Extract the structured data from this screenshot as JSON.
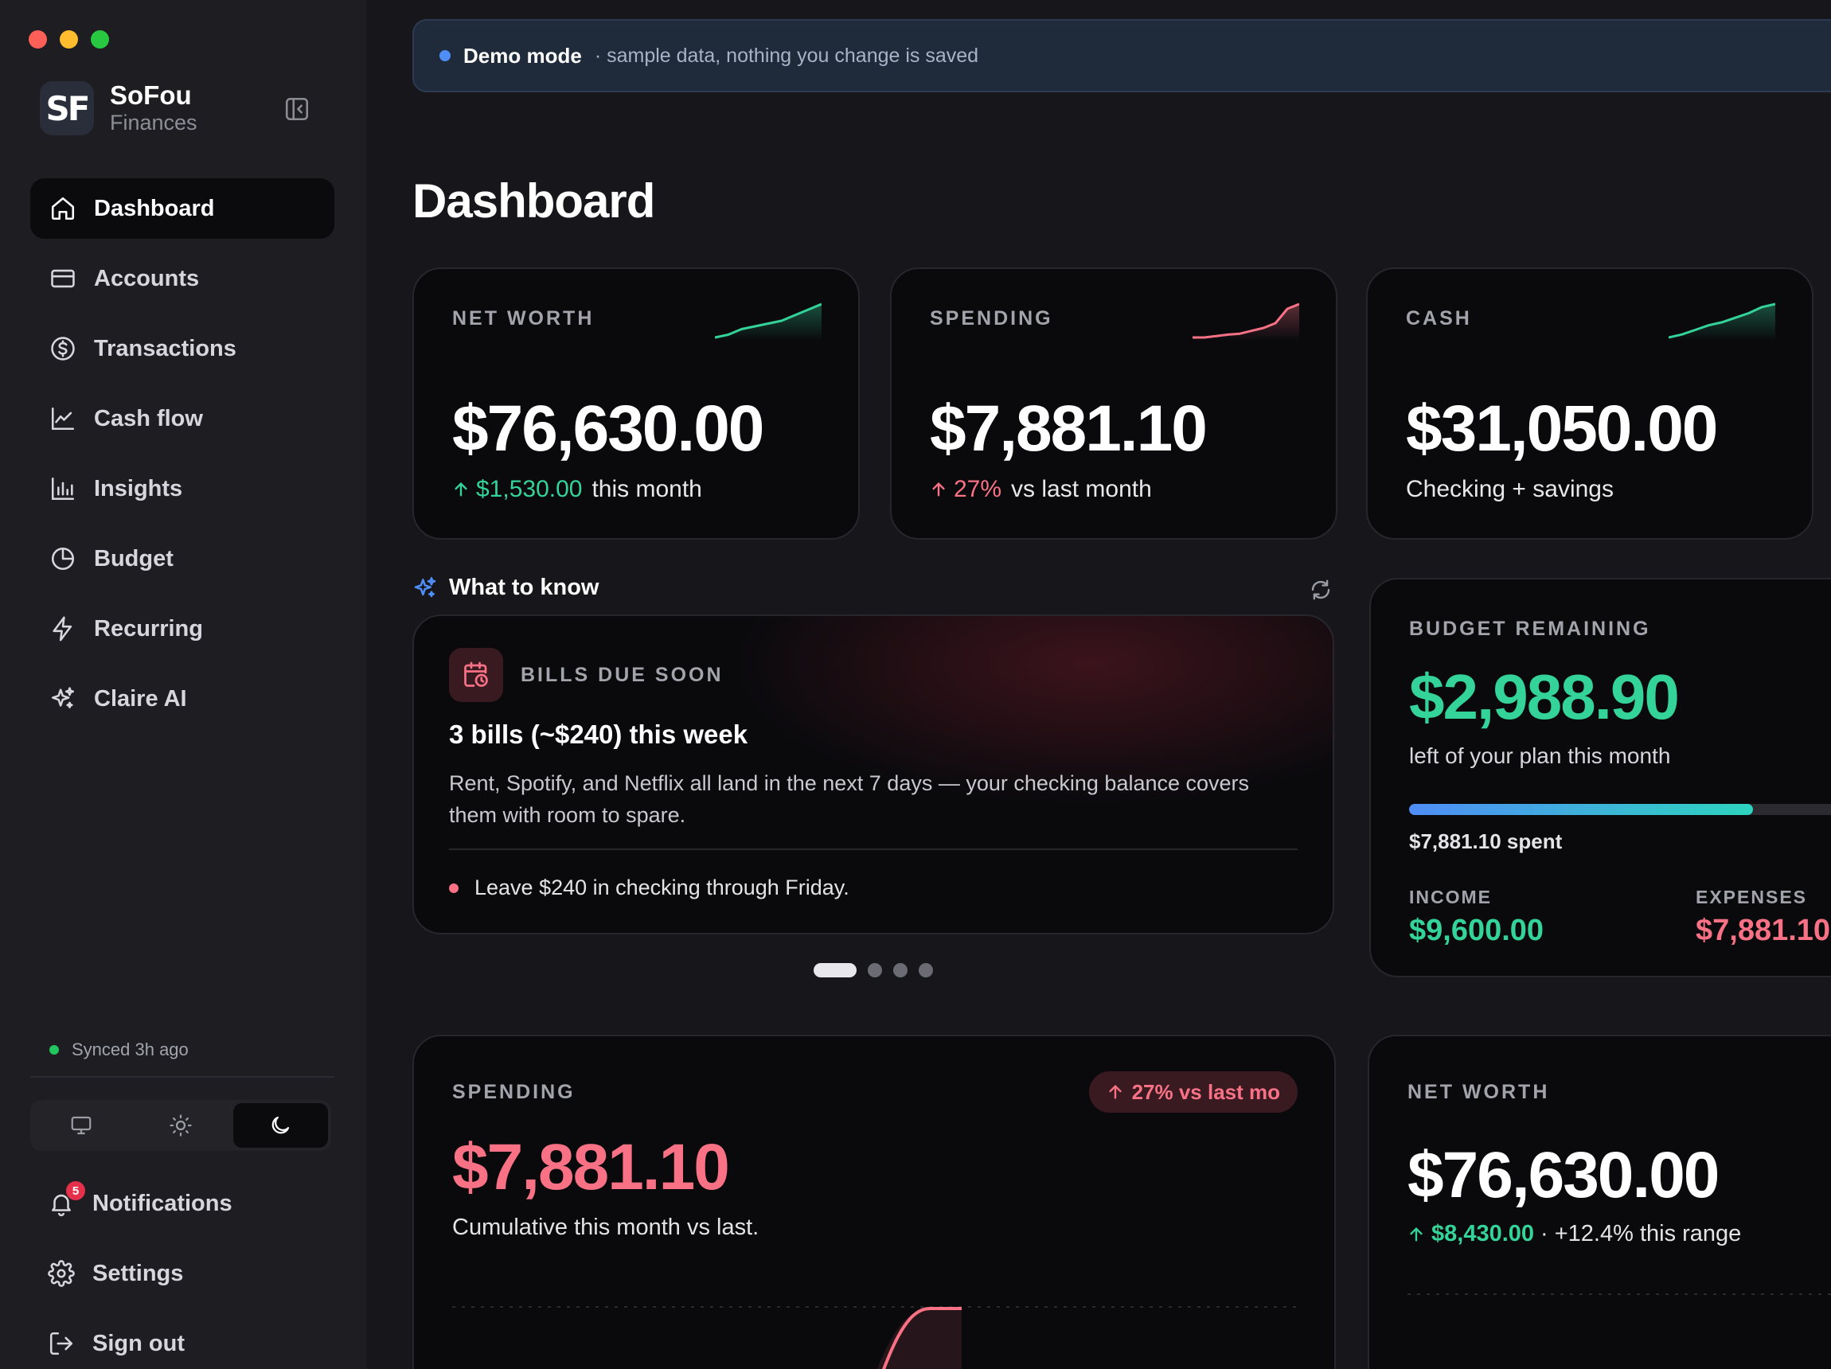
{
  "window": {
    "traffic_lights": [
      "close",
      "minimize",
      "zoom"
    ]
  },
  "brand": {
    "logo": "SF",
    "name": "SoFou",
    "subtitle": "Finances"
  },
  "sidebar": {
    "items": [
      {
        "label": "Dashboard",
        "icon": "home-icon",
        "active": true
      },
      {
        "label": "Accounts",
        "icon": "card-icon"
      },
      {
        "label": "Transactions",
        "icon": "dollar-circle-icon"
      },
      {
        "label": "Cash flow",
        "icon": "line-chart-icon"
      },
      {
        "label": "Insights",
        "icon": "bar-chart-icon"
      },
      {
        "label": "Budget",
        "icon": "pie-chart-icon"
      },
      {
        "label": "Recurring",
        "icon": "bolt-icon"
      },
      {
        "label": "Claire AI",
        "icon": "sparkles-icon"
      }
    ],
    "sync_status": "Synced 3h ago",
    "theme_options": [
      "system",
      "light",
      "dark"
    ],
    "theme_selected": "dark",
    "bottom": {
      "notifications": {
        "label": "Notifications",
        "count": "5"
      },
      "settings": {
        "label": "Settings"
      },
      "signout": {
        "label": "Sign out"
      }
    }
  },
  "banner": {
    "title": "Demo mode",
    "note": "· sample data, nothing you change is saved"
  },
  "page": {
    "title": "Dashboard"
  },
  "kpis": [
    {
      "label": "NET WORTH",
      "value": "$76,630.00",
      "delta": "$1,530.00",
      "delta_dir": "up",
      "delta_color": "#34d399",
      "suffix": "this month",
      "spark_color": "#34d399",
      "spark": [
        2,
        3,
        5,
        6,
        7,
        8,
        10,
        12,
        14
      ]
    },
    {
      "label": "SPENDING",
      "value": "$7,881.10",
      "delta": "27%",
      "delta_dir": "up",
      "delta_color": "#f87185",
      "suffix": "vs last month",
      "spark_color": "#f87185",
      "spark": [
        1,
        1,
        1.3,
        1.6,
        1.8,
        2.4,
        3,
        4,
        7,
        8
      ]
    },
    {
      "label": "CASH",
      "value": "$31,050.00",
      "suffix": "Checking + savings",
      "spark_color": "#34d399",
      "spark": [
        2,
        3,
        4.5,
        6,
        7,
        8.5,
        10,
        12,
        13
      ]
    }
  ],
  "what_to_know": {
    "heading": "What to know",
    "card": {
      "kicker": "BILLS DUE SOON",
      "title": "3 bills (~$240) this week",
      "body": "Rent, Spotify, and Netflix all land in the next 7 days — your checking balance covers them with room to spare.",
      "tip": "Leave $240 in checking through Friday."
    },
    "pages": 4,
    "current_page": 1
  },
  "budget": {
    "label": "BUDGET REMAINING",
    "value": "$2,988.90",
    "subtitle": "left of your plan this month",
    "progress": 0.72,
    "spent": "$7,881.10 spent",
    "income_label": "INCOME",
    "income_value": "$9,600.00",
    "expenses_label": "EXPENSES",
    "expenses_value": "$7,881.10"
  },
  "spending_card": {
    "label": "SPENDING",
    "pill": "27% vs last mo",
    "value": "$7,881.10",
    "subtitle": "Cumulative this month vs last."
  },
  "networth_card": {
    "label": "NET WORTH",
    "value": "$76,630.00",
    "delta": "$8,430.00",
    "delta_note": "· +12.4% this range"
  },
  "colors": {
    "accent_green": "#34d399",
    "accent_red": "#f87185",
    "accent_blue": "#4f8df7"
  }
}
